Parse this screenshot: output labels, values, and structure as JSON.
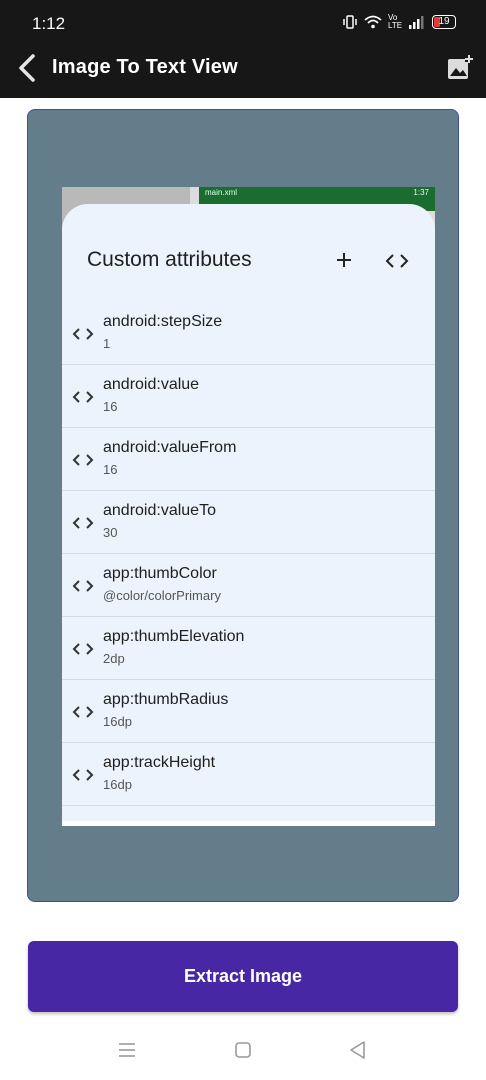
{
  "status_bar": {
    "time": "1:12",
    "network": "Vo LTE",
    "battery": "19"
  },
  "app_bar": {
    "title": "Image To Text View",
    "back_icon": "chevron-left-icon",
    "action_icon": "add-photo-icon"
  },
  "preview": {
    "background": "#647d8b",
    "screenshot": {
      "status_file": "main.xml",
      "status_time": "1:37",
      "sheet_title": "Custom attributes",
      "attributes": [
        {
          "name": "android:stepSize",
          "value": "1"
        },
        {
          "name": "android:value",
          "value": "16"
        },
        {
          "name": "android:valueFrom",
          "value": "16"
        },
        {
          "name": "android:valueTo",
          "value": "30"
        },
        {
          "name": "app:thumbColor",
          "value": "@color/colorPrimary"
        },
        {
          "name": "app:thumbElevation",
          "value": "2dp"
        },
        {
          "name": "app:thumbRadius",
          "value": "16dp"
        },
        {
          "name": "app:trackHeight",
          "value": "16dp"
        }
      ]
    }
  },
  "extract_button": {
    "label": "Extract Image",
    "color": "#4727a3"
  },
  "nav_bar": [
    "menu-icon",
    "home-square-icon",
    "back-triangle-icon"
  ]
}
